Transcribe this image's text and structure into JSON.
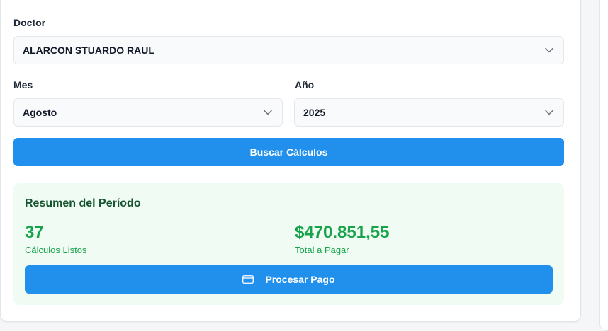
{
  "form": {
    "doctor_label": "Doctor",
    "doctor_value": "ALARCON STUARDO RAUL",
    "month_label": "Mes",
    "month_value": "Agosto",
    "year_label": "Año",
    "year_value": "2025",
    "search_button": "Buscar Cálculos"
  },
  "summary": {
    "title": "Resumen del Período",
    "ready_count": "37",
    "ready_label": "Cálculos Listos",
    "total_amount": "$470.851,55",
    "total_label": "Total a Pagar",
    "process_button": "Procesar Pago"
  },
  "icons": {
    "select": "chevron-down-icon",
    "process": "credit-card-icon"
  },
  "colors": {
    "primary": "#2090ec",
    "success_bg": "#effbf3",
    "success_text": "#16a34a",
    "summary_title": "#14532d"
  }
}
